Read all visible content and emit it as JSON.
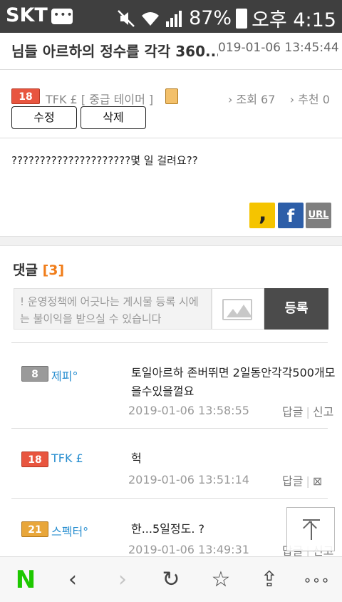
{
  "status_bar": {
    "carrier": "SKT",
    "battery": "87%",
    "time": "오후 4:15"
  },
  "post": {
    "title": "님들 아르하의 정수를 각각 360...",
    "date": "019-01-06 13:45:44",
    "author_level": "18",
    "author": "TFK £ [ 중급 테이머 ]",
    "views_label": "› 조회 67",
    "recommend_label": "› 추천 0",
    "edit_label": "수정",
    "delete_label": "삭제",
    "body": "?????????????????????몇 일 걸려요??"
  },
  "share": {
    "kakao": "kakao-share",
    "facebook": "f",
    "url": "URL"
  },
  "comments": {
    "title": "댓글",
    "count": "[3]",
    "input_placeholder": "! 운영정책에 어긋나는 게시물 등록 시에는 불이익을 받으실 수 있습니다",
    "submit_label": "등록",
    "items": [
      {
        "level": "8",
        "name": "제피°",
        "text": "토일아르하 존버뛰면 2일동안각각500개모을수있을껄요",
        "date": "2019-01-06 13:58:55",
        "reply": "답글",
        "report": "신고"
      },
      {
        "level": "18",
        "name": "TFK £",
        "text": "헉",
        "date": "2019-01-06 13:51:14",
        "reply": "답글",
        "report": "⊠"
      },
      {
        "level": "21",
        "name": "스펙터°",
        "text": "한...5일정도. ?",
        "date": "2019-01-06 13:49:31",
        "reply": "답글",
        "report": "신고"
      }
    ]
  },
  "bottom_bar": {
    "home": "N",
    "back": "‹",
    "forward": "›",
    "refresh": "↻",
    "bookmark": "☆",
    "share": "⇪",
    "more": "∘∘∘"
  },
  "colors": {
    "accent_count": "#f07d1a",
    "name_link": "#2a8fd0",
    "naver_green": "#1ec800"
  }
}
